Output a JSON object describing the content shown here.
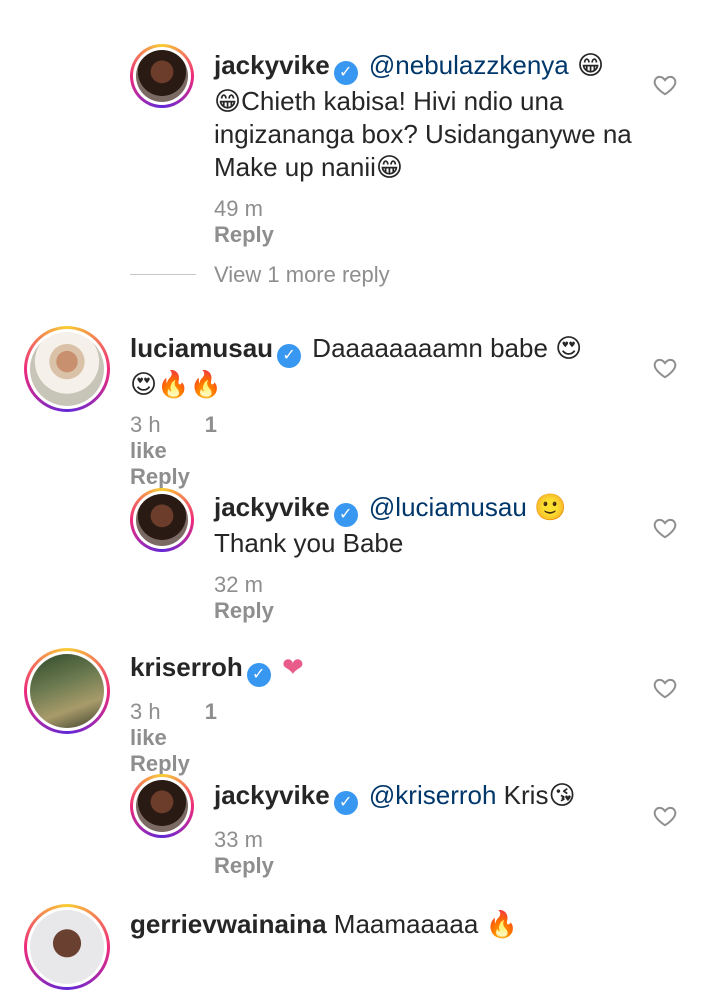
{
  "comments": [
    {
      "username": "jackyvike",
      "segments": [
        {
          "type": "mention",
          "text": "@nebulazzkenya"
        },
        {
          "type": "emoji",
          "text": " 😁"
        },
        {
          "type": "text",
          "text": "😁Chieth kabisa! Hivi ndio una ingizananga box? Usidanganywe na Make up nanii😁"
        }
      ],
      "time": "49 m",
      "reply_label": "Reply"
    },
    {
      "view_more": "View 1 more reply"
    },
    {
      "username": "luciamusau",
      "text": "Daaaaaaaamn babe 😍",
      "emojis_line2": "😍🔥🔥",
      "time": "3 h",
      "likes": "1 like",
      "reply_label": "Reply"
    },
    {
      "username": "jackyvike",
      "mention": "@luciamusau",
      "emoji": "🙂",
      "text": "Thank you Babe",
      "time": "32 m",
      "reply_label": "Reply"
    },
    {
      "username": "kriserroh",
      "text": "❤",
      "time": "3 h",
      "likes": "1 like",
      "reply_label": "Reply"
    },
    {
      "username": "jackyvike",
      "mention": "@kriserroh",
      "text": "Kris😘",
      "time": "33 m",
      "reply_label": "Reply"
    },
    {
      "username": "gerrievwainaina",
      "text": "Maamaaaaa 🔥"
    }
  ],
  "icons": {
    "verified": "verified-badge-icon",
    "like": "heart-outline-icon"
  },
  "colors": {
    "mention": "#00376b",
    "verified": "#3897f0",
    "meta": "#8e8e8e"
  }
}
